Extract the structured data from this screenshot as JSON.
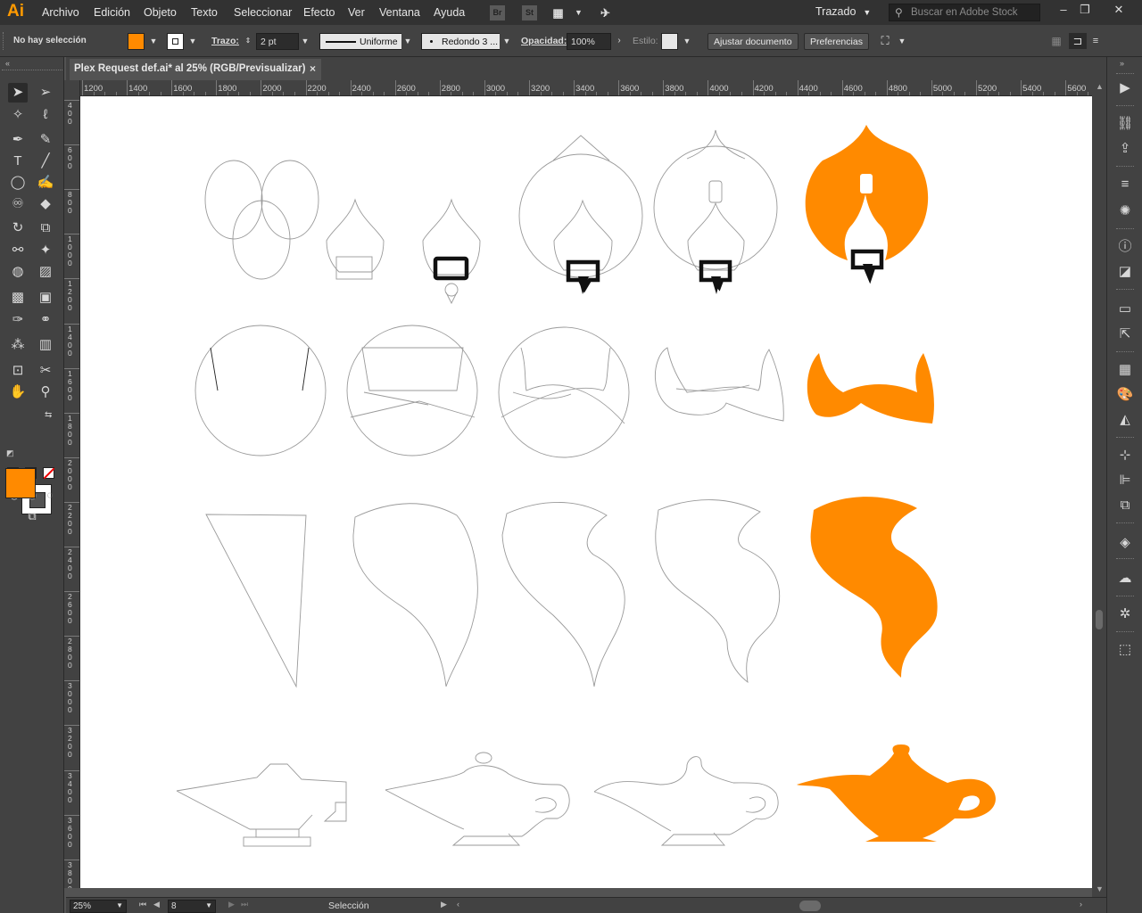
{
  "app": {
    "logo": "Ai"
  },
  "menubar": {
    "items": [
      "Archivo",
      "Edición",
      "Objeto",
      "Texto",
      "Seleccionar",
      "Efecto",
      "Ver",
      "Ventana",
      "Ayuda"
    ],
    "bridge": "Br",
    "stock": "St",
    "workspace": "Trazado",
    "search_placeholder": "Buscar en Adobe Stock"
  },
  "controlbar": {
    "selection": "No hay selección",
    "fill_color": "#ff8a00",
    "stroke_label": "Trazo:",
    "stroke_weight": "2 pt",
    "stroke_profile": "Uniforme",
    "brush": "Redondo 3 ...",
    "opacity_label": "Opacidad:",
    "opacity_value": "100%",
    "style_label": "Estilo:",
    "adjust_button": "Ajustar documento",
    "prefs_button": "Preferencias"
  },
  "document": {
    "tab_title": "Plex Request def.ai* al 25% (RGB/Previsualizar)",
    "close": "×"
  },
  "ruler": {
    "top_labels": [
      "1200",
      "1400",
      "1600",
      "1800",
      "2000",
      "2200",
      "2400",
      "2600",
      "2800",
      "3000",
      "3200",
      "3400",
      "3600",
      "3800",
      "4000",
      "4200",
      "4400",
      "4600",
      "4800",
      "5000",
      "5200",
      "5400",
      "5600"
    ],
    "left_labels": [
      "400",
      "600",
      "800",
      "1000",
      "1200",
      "1400",
      "1600",
      "1800",
      "2000",
      "2200",
      "2400",
      "2600",
      "2800",
      "3000",
      "3200",
      "3400",
      "3600",
      "3800"
    ]
  },
  "toolbar": {
    "fill_color": "#ff8a00",
    "stroke_color": "#ffffff"
  },
  "status": {
    "zoom": "25%",
    "page": "8",
    "text": "Selección"
  },
  "colors": {
    "accent_orange": "#ff8a00",
    "outline": "#9a9a9a"
  }
}
